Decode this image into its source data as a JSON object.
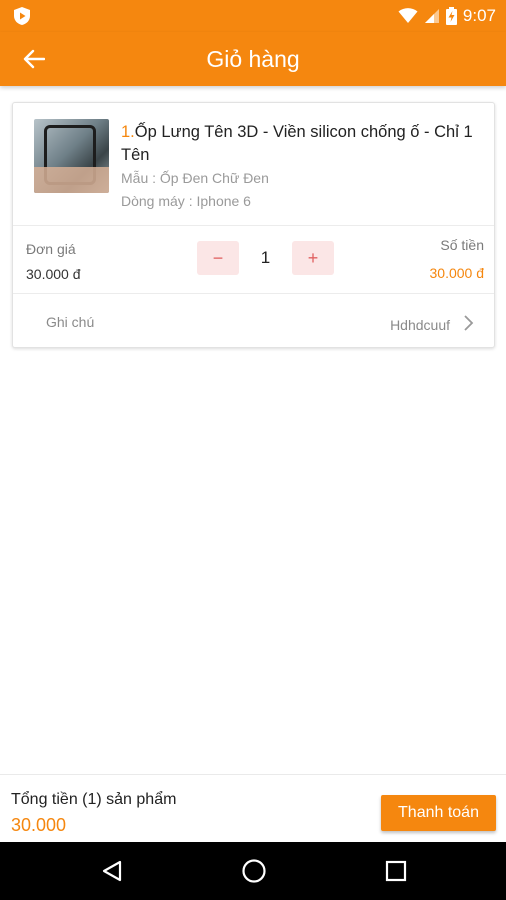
{
  "status_bar": {
    "time": "9:07",
    "icons": [
      "app-notification-icon",
      "wifi-icon",
      "signal-icon",
      "battery-charging-icon"
    ]
  },
  "app_bar": {
    "title": "Giỏ hàng",
    "back_icon": "arrow-left-icon"
  },
  "cart": {
    "items": [
      {
        "index": "1.",
        "name": "Ốp Lưng Tên 3D - Viền silicon chống ố - Chỉ 1 Tên",
        "variant": "Mẫu : Ốp Đen Chữ Đen",
        "model": "Dòng máy : Iphone 6",
        "unit_price_label": "Đơn giá",
        "unit_price": "30.000 đ",
        "quantity": "1",
        "minus_label": "−",
        "plus_label": "+",
        "amount_label": "Số tiền",
        "amount": "30.000 đ",
        "note_label": "Ghi chú",
        "note_value": "Hdhdcuuf"
      }
    ]
  },
  "footer": {
    "total_label": "Tổng tiền (1) sản phẩm",
    "total_value": "30.000",
    "checkout_label": "Thanh toán"
  },
  "colors": {
    "brand": "#f5870f",
    "qty_button_bg": "#fbe6e6",
    "qty_button_text": "#e06060"
  }
}
